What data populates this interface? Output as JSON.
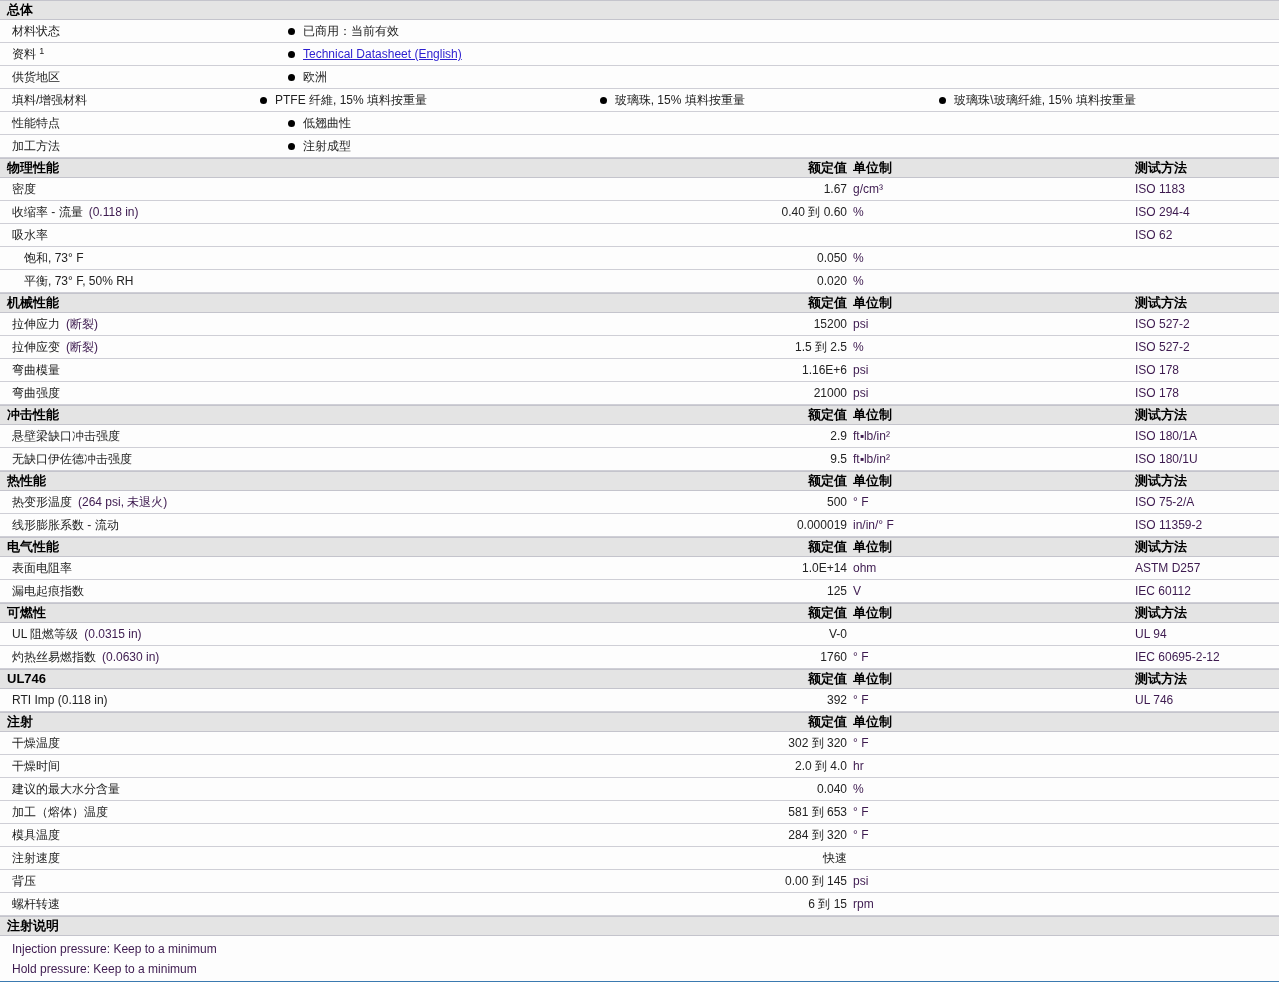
{
  "sections": [
    {
      "title": "总体",
      "kind": "general",
      "rows": [
        {
          "label": "材料状态",
          "items": [
            {
              "kind": "text",
              "text": "已商用：当前有效"
            }
          ]
        },
        {
          "label": "资料 $^{1}$",
          "items": [
            {
              "kind": "link",
              "text": "Technical Datasheet (English)"
            }
          ]
        },
        {
          "label": "供货地区",
          "items": [
            {
              "kind": "text",
              "text": "欧洲"
            }
          ]
        },
        {
          "label": "填料/增强材料",
          "items": [
            {
              "kind": "text",
              "text": "PTFE 纤維, 15% 填料按重量"
            },
            {
              "kind": "text",
              "text": "玻璃珠, 15% 填料按重量"
            },
            {
              "kind": "text",
              "text": "玻璃珠\\玻璃纤維, 15% 填料按重量"
            }
          ]
        },
        {
          "label": "性能特点",
          "items": [
            {
              "kind": "text",
              "text": "低翘曲性"
            }
          ]
        },
        {
          "label": "加工方法",
          "items": [
            {
              "kind": "text",
              "text": "注射成型"
            }
          ]
        }
      ]
    },
    {
      "title": "物理性能",
      "kind": "property",
      "columns": [
        "额定值",
        "单位制",
        "测试方法"
      ],
      "rows": [
        {
          "label": "密度",
          "value": "1.67",
          "unit": "g/cm³",
          "method": "ISO 1183"
        },
        {
          "label": "收缩率  - 流量",
          "condition": "(0.118 in)",
          "value": "0.40 到  0.60",
          "unit": "%",
          "method": "ISO 294-4"
        },
        {
          "label": "吸水率",
          "method": "ISO 62",
          "children": [
            {
              "label": "饱和, 73° F",
              "value": "0.050",
              "unit": "%"
            },
            {
              "label": "平衡, 73° F, 50% RH",
              "value": "0.020",
              "unit": "%"
            }
          ]
        }
      ]
    },
    {
      "title": "机械性能",
      "kind": "property",
      "columns": [
        "额定值",
        "单位制",
        "测试方法"
      ],
      "rows": [
        {
          "label": "拉伸应力",
          "condition": "(断裂)",
          "value": "15200",
          "unit": "psi",
          "method": "ISO 527-2"
        },
        {
          "label": "拉伸应变",
          "condition": "(断裂)",
          "value": "1.5 到  2.5",
          "unit": "%",
          "method": "ISO 527-2"
        },
        {
          "label": "弯曲模量",
          "value": "1.16E+6",
          "unit": "psi",
          "method": "ISO 178"
        },
        {
          "label": "弯曲强度",
          "value": "21000",
          "unit": "psi",
          "method": "ISO 178"
        }
      ]
    },
    {
      "title": "冲击性能",
      "kind": "property",
      "columns": [
        "额定值",
        "单位制",
        "测试方法"
      ],
      "rows": [
        {
          "label": "悬壁梁缺口冲击强度",
          "value": "2.9",
          "unit": "ft▪lb/in²",
          "method": "ISO 180/1A"
        },
        {
          "label": "无缺口伊佐德冲击强度",
          "value": "9.5",
          "unit": "ft▪lb/in²",
          "method": "ISO 180/1U"
        }
      ]
    },
    {
      "title": "热性能",
      "kind": "property",
      "columns": [
        "额定值",
        "单位制",
        "测试方法"
      ],
      "rows": [
        {
          "label": "热变形温度",
          "condition": "(264 psi, 未退火)",
          "value": "500",
          "unit": "° F",
          "method": "ISO 75-2/A"
        },
        {
          "label": "线形膨胀系数  - 流动",
          "value": "0.000019",
          "unit": "in/in/° F",
          "method": "ISO 11359-2"
        }
      ]
    },
    {
      "title": "电气性能",
      "kind": "property",
      "columns": [
        "额定值",
        "单位制",
        "测试方法"
      ],
      "rows": [
        {
          "label": "表面电阻率",
          "value": "1.0E+14",
          "unit": "ohm",
          "method": "ASTM D257"
        },
        {
          "label": "漏电起痕指数",
          "value": "125",
          "unit": "V",
          "method": "IEC 60112"
        }
      ]
    },
    {
      "title": "可燃性",
      "kind": "property",
      "columns": [
        "额定值",
        "单位制",
        "测试方法"
      ],
      "rows": [
        {
          "label": "UL 阻燃等级",
          "condition": "(0.0315 in)",
          "value": "V-0",
          "method": "UL 94"
        },
        {
          "label": "灼热丝易燃指数",
          "condition": "(0.0630 in)",
          "value": "1760",
          "unit": "° F",
          "method": "IEC 60695-2-12"
        }
      ]
    },
    {
      "title": "UL746",
      "kind": "property",
      "columns": [
        "额定值",
        "单位制",
        "测试方法"
      ],
      "rows": [
        {
          "label": "RTI Imp (0.118 in)",
          "value": "392",
          "unit": "° F",
          "method": "UL 746"
        }
      ]
    },
    {
      "title": "注射",
      "kind": "property",
      "columns": [
        "额定值",
        "单位制"
      ],
      "rows": [
        {
          "label": "干燥温度",
          "value": "302 到  320",
          "unit": "° F"
        },
        {
          "label": "干燥时间",
          "value": "2.0 到  4.0",
          "unit": "hr"
        },
        {
          "label": "建议的最大水分含量",
          "value": "0.040",
          "unit": "%"
        },
        {
          "label": "加工（熔体）温度",
          "value": "581 到  653",
          "unit": "° F"
        },
        {
          "label": "模具温度",
          "value": "284 到  320",
          "unit": "° F"
        },
        {
          "label": "注射速度",
          "value": "快速"
        },
        {
          "label": "背压",
          "value": "0.00 到  145",
          "unit": "psi"
        },
        {
          "label": "螺杆转速",
          "value": "6 到  15",
          "unit": "rpm"
        }
      ]
    },
    {
      "title": "注射说明",
      "kind": "notes",
      "lines": [
        "Injection pressure: Keep to a minimum",
        "Hold pressure: Keep to a minimum"
      ]
    }
  ]
}
